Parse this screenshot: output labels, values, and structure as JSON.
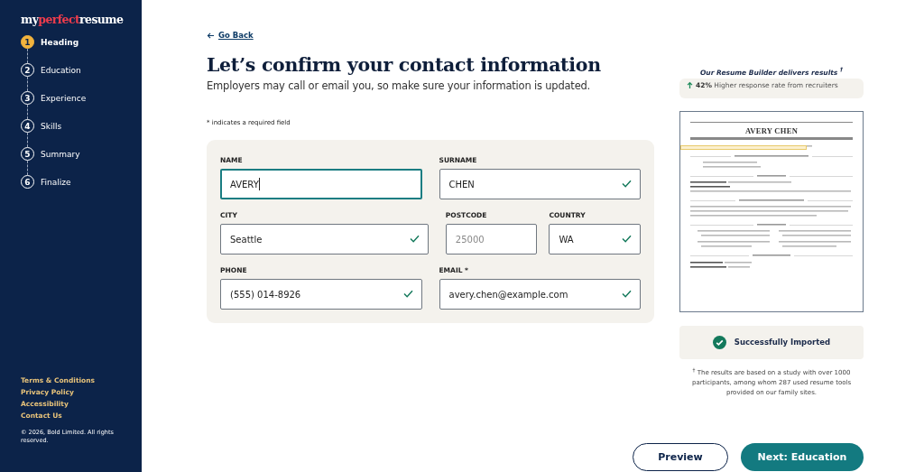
{
  "sidebar": {
    "logo": [
      {
        "text": "my",
        "accent": false
      },
      {
        "text": "perfect",
        "accent": true
      },
      {
        "text": "resume",
        "accent": false
      }
    ],
    "steps": [
      {
        "number": "1",
        "label": "Heading",
        "selected": true
      },
      {
        "number": "2",
        "label": "Education",
        "selected": false
      },
      {
        "number": "3",
        "label": "Experience",
        "selected": false
      },
      {
        "number": "4",
        "label": "Skills",
        "selected": false
      },
      {
        "number": "5",
        "label": "Summary",
        "selected": false
      },
      {
        "number": "6",
        "label": "Finalize",
        "selected": false
      }
    ],
    "links": [
      "Terms & Conditions",
      "Privacy Policy",
      "Accessibility",
      "Contact Us"
    ],
    "copyright": "© 2026, Bold Limited. All rights reserved."
  },
  "back_link": "Go Back",
  "title": "Let’s confirm your contact information",
  "subtitle": "Employers may call or email you, so make sure your information is updated.",
  "required_note": "* indicates a required field",
  "form": {
    "rows": [
      [
        {
          "label": "NAME",
          "value": "AVERY",
          "focused": true,
          "valid": false
        },
        {
          "label": "SURNAME",
          "value": "CHEN",
          "focused": false,
          "valid": true
        }
      ],
      [
        {
          "label": "CITY",
          "value": "Seattle",
          "focused": false,
          "valid": true
        },
        {
          "label": "POSTCODE",
          "placeholder": "25000",
          "focused": false,
          "valid": false
        },
        {
          "label": "COUNTRY",
          "value": "WA",
          "focused": false,
          "valid": true
        }
      ],
      [
        {
          "label": "PHONE",
          "value": "(555) 014-8926",
          "focused": false,
          "valid": true
        },
        {
          "label": "EMAIL *",
          "value": "avery.chen@example.com",
          "focused": false,
          "valid": true
        }
      ]
    ]
  },
  "results": {
    "heading": "Our Resume Builder delivers results $^{†}$",
    "stat": "42%",
    "stat_text": "Higher response rate from recruiters"
  },
  "resume": {
    "name": "AVERY CHEN"
  },
  "import_status": "Successfully Imported",
  "footnote": "$^{†}$ The results are based on a study with over 1000 participants, among whom 287 used resume tools provided on our family sites.",
  "buttons": [
    {
      "label": "Preview",
      "kind": "secondary"
    },
    {
      "label": "Next: Education",
      "kind": "primary"
    }
  ]
}
